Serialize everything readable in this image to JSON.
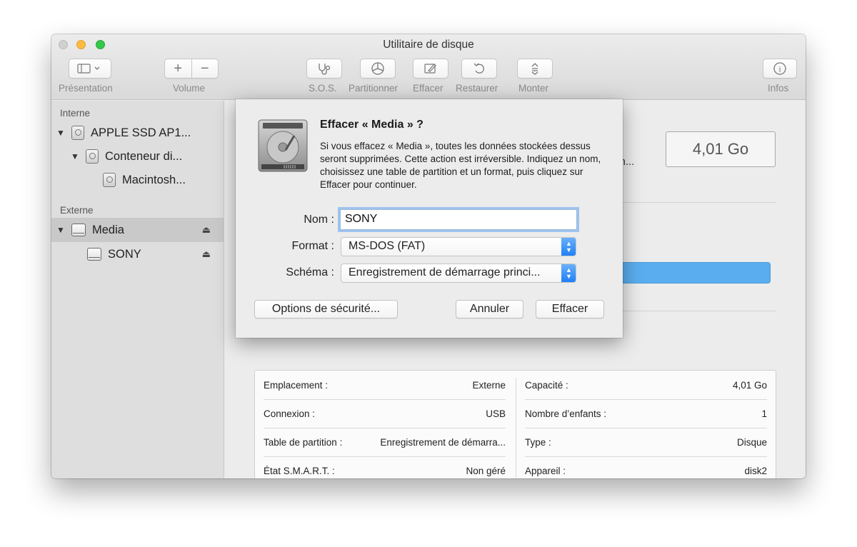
{
  "window": {
    "title": "Utilitaire de disque"
  },
  "toolbar": {
    "presentation_label": "Présentation",
    "volume_label": "Volume",
    "sos_label": "S.O.S.",
    "partition_label": "Partitionner",
    "erase_label": "Effacer",
    "restore_label": "Restaurer",
    "mount_label": "Monter",
    "info_label": "Infos",
    "volume_add": "+",
    "volume_remove": "−",
    "info_glyph": "i"
  },
  "sidebar": {
    "internal_header": "Interne",
    "external_header": "Externe",
    "items": [
      {
        "label": "APPLE SSD AP1..."
      },
      {
        "label": "Conteneur di..."
      },
      {
        "label": "Macintosh..."
      },
      {
        "label": "Media"
      },
      {
        "label": "SONY"
      }
    ],
    "eject_glyph": "⏏"
  },
  "main": {
    "capacity": "4,01 Go",
    "hidden_text": "ém...",
    "usage_fraction": 0.0
  },
  "info": {
    "left": [
      {
        "key": "Emplacement :",
        "value": "Externe"
      },
      {
        "key": "Connexion :",
        "value": "USB"
      },
      {
        "key": "Table de partition :",
        "value": "Enregistrement de démarra..."
      },
      {
        "key": "État S.M.A.R.T. :",
        "value": "Non géré"
      }
    ],
    "right": [
      {
        "key": "Capacité :",
        "value": "4,01 Go"
      },
      {
        "key": "Nombre d’enfants :",
        "value": "1"
      },
      {
        "key": "Type :",
        "value": "Disque"
      },
      {
        "key": "Appareil :",
        "value": "disk2"
      }
    ]
  },
  "sheet": {
    "title": "Effacer « Media » ?",
    "message": "Si vous effacez « Media », toutes les données stockées dessus seront supprimées. Cette action est irréversible. Indiquez un nom, choisissez une table de partition et un format, puis cliquez sur Effacer pour continuer.",
    "name_label": "Nom :",
    "name_value": "SONY",
    "format_label": "Format :",
    "format_value": "MS-DOS (FAT)",
    "scheme_label": "Schéma :",
    "scheme_value": "Enregistrement de démarrage princi...",
    "security_button": "Options de sécurité...",
    "cancel_button": "Annuler",
    "erase_button": "Effacer"
  },
  "colors": {
    "accent": "#1c7ef6",
    "usage_bar": "#5aaeef",
    "focus_ring": "#9dc3ef"
  }
}
